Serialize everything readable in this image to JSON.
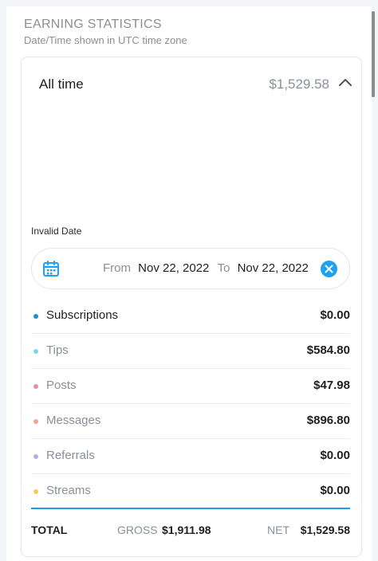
{
  "header": {
    "title": "EARNING STATISTICS",
    "subtitle": "Date/Time shown in UTC time zone"
  },
  "card": {
    "period_label": "All time",
    "period_amount": "$1,529.58",
    "invalid_date_text": "Invalid Date",
    "date_range": {
      "from_label": "From",
      "from_value": "Nov 22, 2022",
      "to_label": "To",
      "to_value": "Nov 22, 2022"
    },
    "rows": [
      {
        "label": "Subscriptions",
        "value": "$0.00",
        "dot_color": "#1f8fc8",
        "label_color": "#1f1f1f"
      },
      {
        "label": "Tips",
        "value": "$584.80",
        "dot_color": "#7fd3e6",
        "label_color": "#8a8f98"
      },
      {
        "label": "Posts",
        "value": "$47.98",
        "dot_color": "#e48fa8",
        "label_color": "#8a8f98"
      },
      {
        "label": "Messages",
        "value": "$896.80",
        "dot_color": "#f0a58e",
        "label_color": "#8a8f98"
      },
      {
        "label": "Referrals",
        "value": "$0.00",
        "dot_color": "#b7acdd",
        "label_color": "#8a8f98"
      },
      {
        "label": "Streams",
        "value": "$0.00",
        "dot_color": "#f3cd5d",
        "label_color": "#8a8f98"
      }
    ],
    "total": {
      "label": "TOTAL",
      "gross_label": "GROSS",
      "gross_value": "$1,911.98",
      "net_label": "NET",
      "net_value": "$1,529.58"
    }
  },
  "icons": {
    "calendar": "calendar-icon",
    "clear": "clear-date-icon",
    "collapse": "chevron-up-icon"
  },
  "colors": {
    "accent": "#1da1f2",
    "divider": "#1fa0d6",
    "muted_text": "#8a8f98"
  }
}
